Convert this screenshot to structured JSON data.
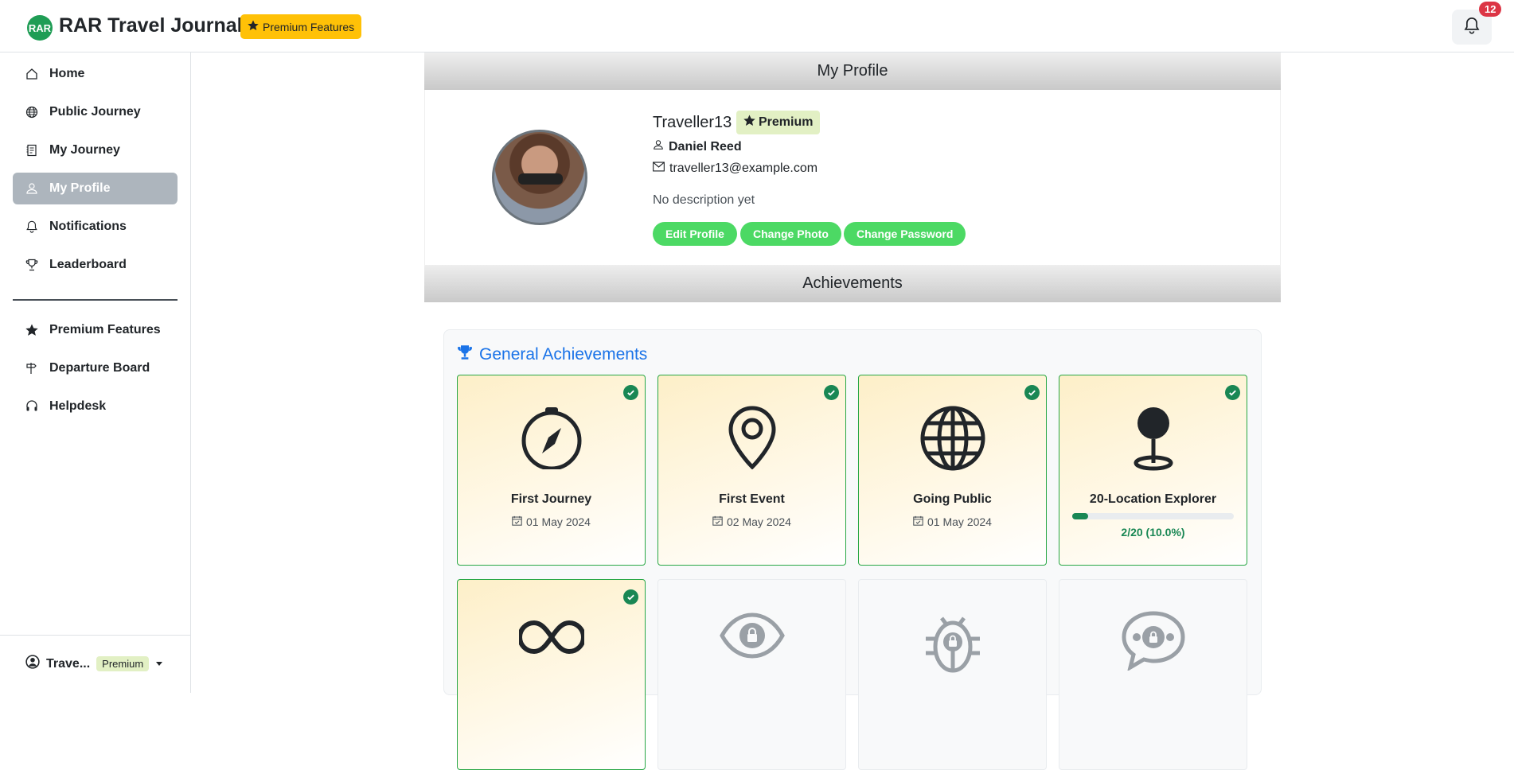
{
  "app": {
    "logo_text": "RAR",
    "title": "RAR Travel Journal",
    "premium_label": "Premium Features",
    "notification_count": "12"
  },
  "sidebar": {
    "items": [
      {
        "label": "Home",
        "icon": "home-icon"
      },
      {
        "label": "Public Journey",
        "icon": "globe-icon"
      },
      {
        "label": "My Journey",
        "icon": "journal-icon"
      },
      {
        "label": "My Profile",
        "icon": "person-icon",
        "active": true
      },
      {
        "label": "Notifications",
        "icon": "bell-icon"
      },
      {
        "label": "Leaderboard",
        "icon": "trophy-icon"
      },
      {
        "label": "Premium Features",
        "icon": "star-icon"
      },
      {
        "label": "Departure Board",
        "icon": "signpost-icon"
      },
      {
        "label": "Helpdesk",
        "icon": "headset-icon"
      }
    ],
    "footer": {
      "user_short": "Trave...",
      "badge": "Premium"
    }
  },
  "profile": {
    "header": "My Profile",
    "username": "Traveller13",
    "badge": "Premium",
    "full_name": "Daniel Reed",
    "email": "traveller13@example.com",
    "description": "No description yet",
    "buttons": {
      "edit": "Edit Profile",
      "photo": "Change Photo",
      "password": "Change Password"
    }
  },
  "achievements": {
    "header": "Achievements",
    "group_title": "General Achievements",
    "tiles": [
      {
        "title": "First Journey",
        "date": "01 May 2024",
        "icon": "compass-icon",
        "unlocked": true
      },
      {
        "title": "First Event",
        "date": "02 May 2024",
        "icon": "location-pin-icon",
        "unlocked": true
      },
      {
        "title": "Going Public",
        "date": "01 May 2024",
        "icon": "globe-icon",
        "unlocked": true
      },
      {
        "title": "20-Location Explorer",
        "icon": "pushpin-icon",
        "unlocked": true,
        "progress_text": "2/20 (10.0%)",
        "progress": 0.1
      },
      {
        "title": "",
        "icon": "infinity-icon",
        "unlocked": true
      },
      {
        "title": "",
        "icon": "eye-lock-icon",
        "unlocked": false
      },
      {
        "title": "",
        "icon": "bug-lock-icon",
        "unlocked": false
      },
      {
        "title": "",
        "icon": "chat-lock-icon",
        "unlocked": false
      }
    ]
  },
  "colors": {
    "accent_green": "#4cd964",
    "success": "#198754",
    "premium_yellow": "#ffc107",
    "link_blue": "#1a73e8"
  }
}
